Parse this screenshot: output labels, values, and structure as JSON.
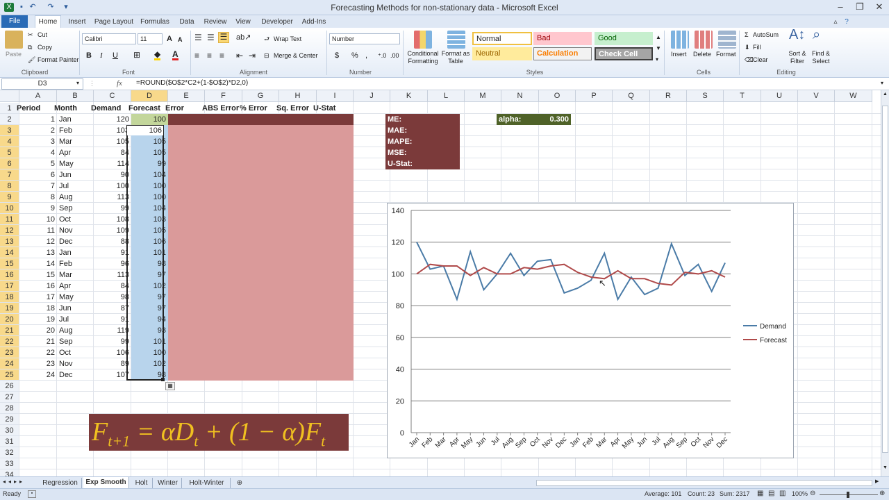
{
  "window": {
    "title": "Forecasting Methods for non-stationary data  -  Microsoft Excel"
  },
  "ribbon": {
    "tabs": [
      "File",
      "Home",
      "Insert",
      "Page Layout",
      "Formulas",
      "Data",
      "Review",
      "View",
      "Developer",
      "Add-Ins"
    ],
    "clipboard": {
      "paste": "Paste",
      "cut": "Cut",
      "copy": "Copy",
      "format_painter": "Format Painter",
      "group": "Clipboard"
    },
    "font": {
      "name": "Calibri",
      "size": "11",
      "bold": "B",
      "italic": "I",
      "underline": "U",
      "group": "Font"
    },
    "alignment": {
      "wrap": "Wrap Text",
      "merge": "Merge & Center",
      "group": "Alignment"
    },
    "number": {
      "format": "Number",
      "currency": "$",
      "percent": "%",
      "comma": ",",
      "group": "Number"
    },
    "styles": {
      "conditional": "Conditional Formatting",
      "format_table": "Format as Table",
      "normal": "Normal",
      "bad": "Bad",
      "good": "Good",
      "neutral": "Neutral",
      "calculation": "Calculation",
      "check_cell": "Check Cell",
      "group": "Styles"
    },
    "cells": {
      "insert": "Insert",
      "delete": "Delete",
      "format": "Format",
      "group": "Cells"
    },
    "editing": {
      "autosum": "AutoSum",
      "fill": "Fill",
      "clear": "Clear",
      "sort": "Sort & Filter",
      "find": "Find & Select",
      "group": "Editing"
    }
  },
  "formula_bar": {
    "name_box": "D3",
    "fx": "fx",
    "formula": "=ROUND($O$2*C2+(1-$O$2)*D2,0)"
  },
  "columns": [
    "A",
    "B",
    "C",
    "D",
    "E",
    "F",
    "G",
    "H",
    "I",
    "J",
    "K",
    "L",
    "M",
    "N",
    "O",
    "P",
    "Q",
    "R",
    "S",
    "T",
    "U",
    "V",
    "W"
  ],
  "headers": {
    "period": "Period",
    "month": "Month",
    "demand": "Demand",
    "forecast": "Forecast",
    "error": "Error",
    "abs_error": "ABS Error",
    "pct_error": "% Error",
    "sq_error": "Sq. Error",
    "ustat": "U-Stat"
  },
  "rows": [
    {
      "period": "1",
      "month": "Jan",
      "demand": "120",
      "forecast": "100"
    },
    {
      "period": "2",
      "month": "Feb",
      "demand": "103",
      "forecast": "106"
    },
    {
      "period": "3",
      "month": "Mar",
      "demand": "105",
      "forecast": "105"
    },
    {
      "period": "4",
      "month": "Apr",
      "demand": "84",
      "forecast": "105"
    },
    {
      "period": "5",
      "month": "May",
      "demand": "114",
      "forecast": "99"
    },
    {
      "period": "6",
      "month": "Jun",
      "demand": "90",
      "forecast": "104"
    },
    {
      "period": "7",
      "month": "Jul",
      "demand": "100",
      "forecast": "100"
    },
    {
      "period": "8",
      "month": "Aug",
      "demand": "113",
      "forecast": "100"
    },
    {
      "period": "9",
      "month": "Sep",
      "demand": "99",
      "forecast": "104"
    },
    {
      "period": "10",
      "month": "Oct",
      "demand": "108",
      "forecast": "103"
    },
    {
      "period": "11",
      "month": "Nov",
      "demand": "109",
      "forecast": "105"
    },
    {
      "period": "12",
      "month": "Dec",
      "demand": "88",
      "forecast": "106"
    },
    {
      "period": "13",
      "month": "Jan",
      "demand": "91",
      "forecast": "101"
    },
    {
      "period": "14",
      "month": "Feb",
      "demand": "96",
      "forecast": "98"
    },
    {
      "period": "15",
      "month": "Mar",
      "demand": "113",
      "forecast": "97"
    },
    {
      "period": "16",
      "month": "Apr",
      "demand": "84",
      "forecast": "102"
    },
    {
      "period": "17",
      "month": "May",
      "demand": "98",
      "forecast": "97"
    },
    {
      "period": "18",
      "month": "Jun",
      "demand": "87",
      "forecast": "97"
    },
    {
      "period": "19",
      "month": "Jul",
      "demand": "91",
      "forecast": "94"
    },
    {
      "period": "20",
      "month": "Aug",
      "demand": "119",
      "forecast": "93"
    },
    {
      "period": "21",
      "month": "Sep",
      "demand": "99",
      "forecast": "101"
    },
    {
      "period": "22",
      "month": "Oct",
      "demand": "106",
      "forecast": "100"
    },
    {
      "period": "23",
      "month": "Nov",
      "demand": "89",
      "forecast": "102"
    },
    {
      "period": "24",
      "month": "Dec",
      "demand": "107",
      "forecast": "98"
    }
  ],
  "metrics": [
    "ME:",
    "MAE:",
    "MAPE:",
    "MSE:",
    "U-Stat:"
  ],
  "alpha": {
    "label": "alpha:",
    "value": "0.300"
  },
  "formula_image": "F_{t+1} = αD_t + (1−α)F_t",
  "sheet_tabs": [
    "Regression",
    "Exp Smooth",
    "Holt",
    "Winter",
    "Holt-Winter"
  ],
  "active_sheet": "Exp Smooth",
  "status": {
    "ready": "Ready",
    "average": "Average: 101",
    "count": "Count: 23",
    "sum": "Sum: 2317",
    "zoom": "100%"
  },
  "colors": {
    "dark_red": "#7b3a3a",
    "pink": "#da9a9a",
    "blue": "#b8d4ec",
    "green": "#c3d69b",
    "demand_line": "#4a7ba7",
    "forecast_line": "#b04a4a"
  },
  "chart_data": {
    "type": "line",
    "categories": [
      "Jan",
      "Feb",
      "Mar",
      "Apr",
      "May",
      "Jun",
      "Jul",
      "Aug",
      "Sep",
      "Oct",
      "Nov",
      "Dec",
      "Jan",
      "Feb",
      "Mar",
      "Apr",
      "May",
      "Jun",
      "Jul",
      "Aug",
      "Sep",
      "Oct",
      "Nov",
      "Dec"
    ],
    "series": [
      {
        "name": "Demand",
        "values": [
          120,
          103,
          105,
          84,
          114,
          90,
          100,
          113,
          99,
          108,
          109,
          88,
          91,
          96,
          113,
          84,
          98,
          87,
          91,
          119,
          99,
          106,
          89,
          107
        ],
        "color": "#4a7ba7"
      },
      {
        "name": "Forecast",
        "values": [
          100,
          106,
          105,
          105,
          99,
          104,
          100,
          100,
          104,
          103,
          105,
          106,
          101,
          98,
          97,
          102,
          97,
          97,
          94,
          93,
          101,
          100,
          102,
          98
        ],
        "color": "#b04a4a"
      }
    ],
    "yticks": [
      "0",
      "20",
      "40",
      "60",
      "80",
      "100",
      "120",
      "140"
    ],
    "ylim": [
      0,
      140
    ],
    "grid": true,
    "legend": "right"
  }
}
